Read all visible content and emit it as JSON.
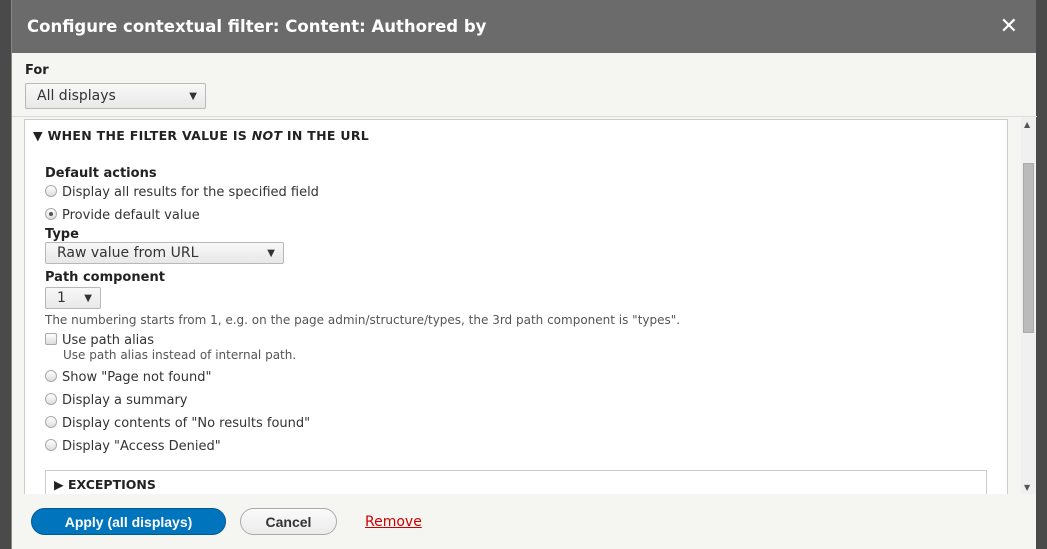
{
  "dialog": {
    "title": "Configure contextual filter: Content: Authored by",
    "close_icon": "close-icon"
  },
  "for": {
    "label": "For",
    "value": "All displays"
  },
  "section": {
    "legend_pre": "WHEN THE FILTER VALUE IS ",
    "legend_em": "NOT",
    "legend_post": " IN THE URL",
    "default_actions_label": "Default actions",
    "opt_all": "Display all results for the specified field",
    "opt_default": "Provide default value",
    "type_label": "Type",
    "type_value": "Raw value from URL",
    "path_label": "Path component",
    "path_value": "1",
    "path_desc": "The numbering starts from 1, e.g. on the page admin/structure/types, the 3rd path component is \"types\".",
    "alias_label": "Use path alias",
    "alias_desc": "Use path alias instead of internal path.",
    "opt_404": "Show \"Page not found\"",
    "opt_summary": "Display a summary",
    "opt_empty": "Display contents of \"No results found\"",
    "opt_denied": "Display \"Access Denied\"",
    "selected": "Provide default value",
    "use_path_alias": false
  },
  "exceptions": {
    "label": "EXCEPTIONS"
  },
  "footer": {
    "apply": "Apply (all displays)",
    "cancel": "Cancel",
    "remove": "Remove"
  }
}
